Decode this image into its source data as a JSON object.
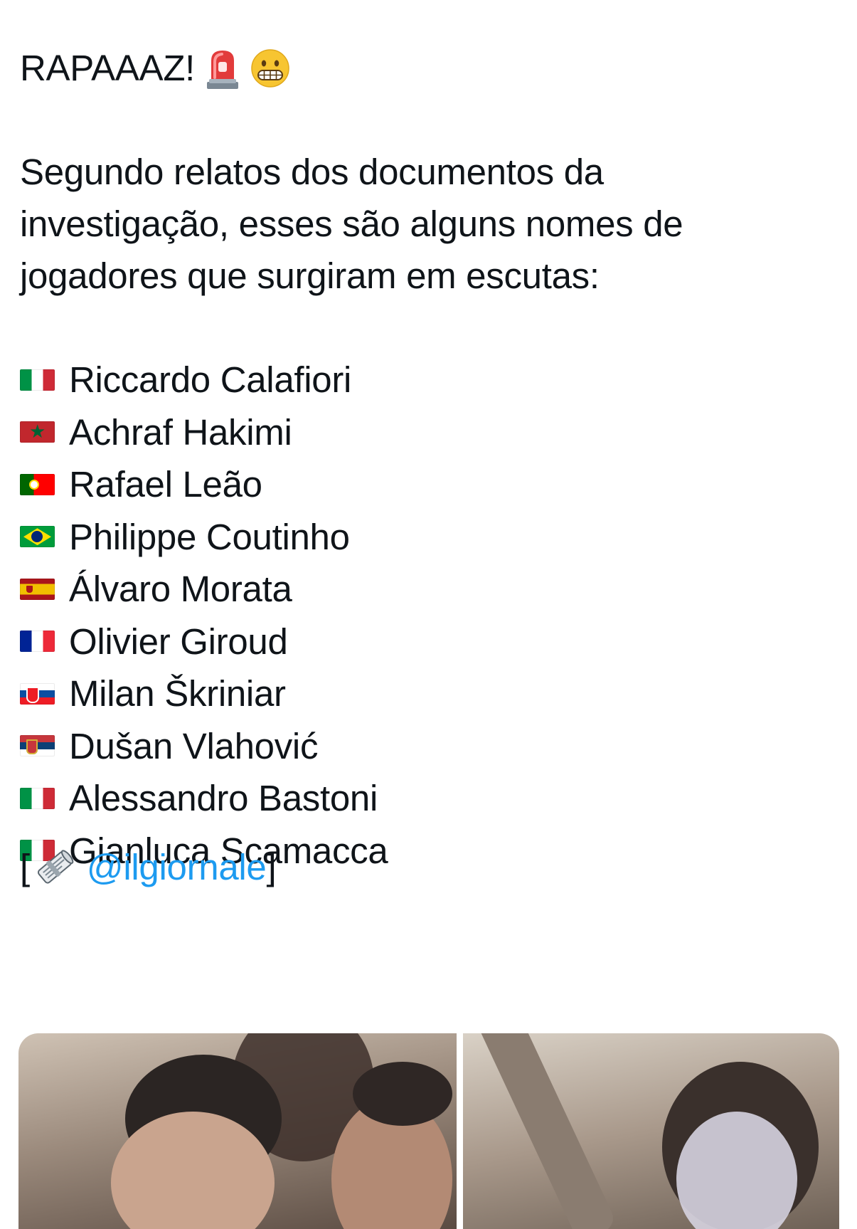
{
  "tweet": {
    "headline": "RAPAAAZ!",
    "headline_icons": [
      "rotating-light-icon",
      "grimacing-face-icon"
    ],
    "intro_lines": [
      "Segundo relatos dos documentos da",
      "investigação, esses são alguns nomes de",
      "jogadores que surgiram em escutas:"
    ],
    "players": [
      {
        "flag": "it",
        "name": "Riccardo Calafiori"
      },
      {
        "flag": "ma",
        "name": "Achraf Hakimi"
      },
      {
        "flag": "pt",
        "name": "Rafael Leão"
      },
      {
        "flag": "br",
        "name": "Philippe Coutinho"
      },
      {
        "flag": "es",
        "name": "Álvaro Morata"
      },
      {
        "flag": "fr",
        "name": "Olivier Giroud"
      },
      {
        "flag": "sk",
        "name": "Milan Škriniar"
      },
      {
        "flag": "rs",
        "name": "Dušan Vlahović"
      },
      {
        "flag": "it",
        "name": "Alessandro Bastoni"
      },
      {
        "flag": "it",
        "name": "Gianluca Scamacca"
      }
    ],
    "source": {
      "open_bracket": "[",
      "icon": "rolled-newspaper-icon",
      "mention": "@ilgiornale",
      "close_bracket": "]"
    }
  },
  "colors": {
    "text": "#0f1419",
    "mention": "#1d9bf0",
    "background": "#ffffff"
  }
}
